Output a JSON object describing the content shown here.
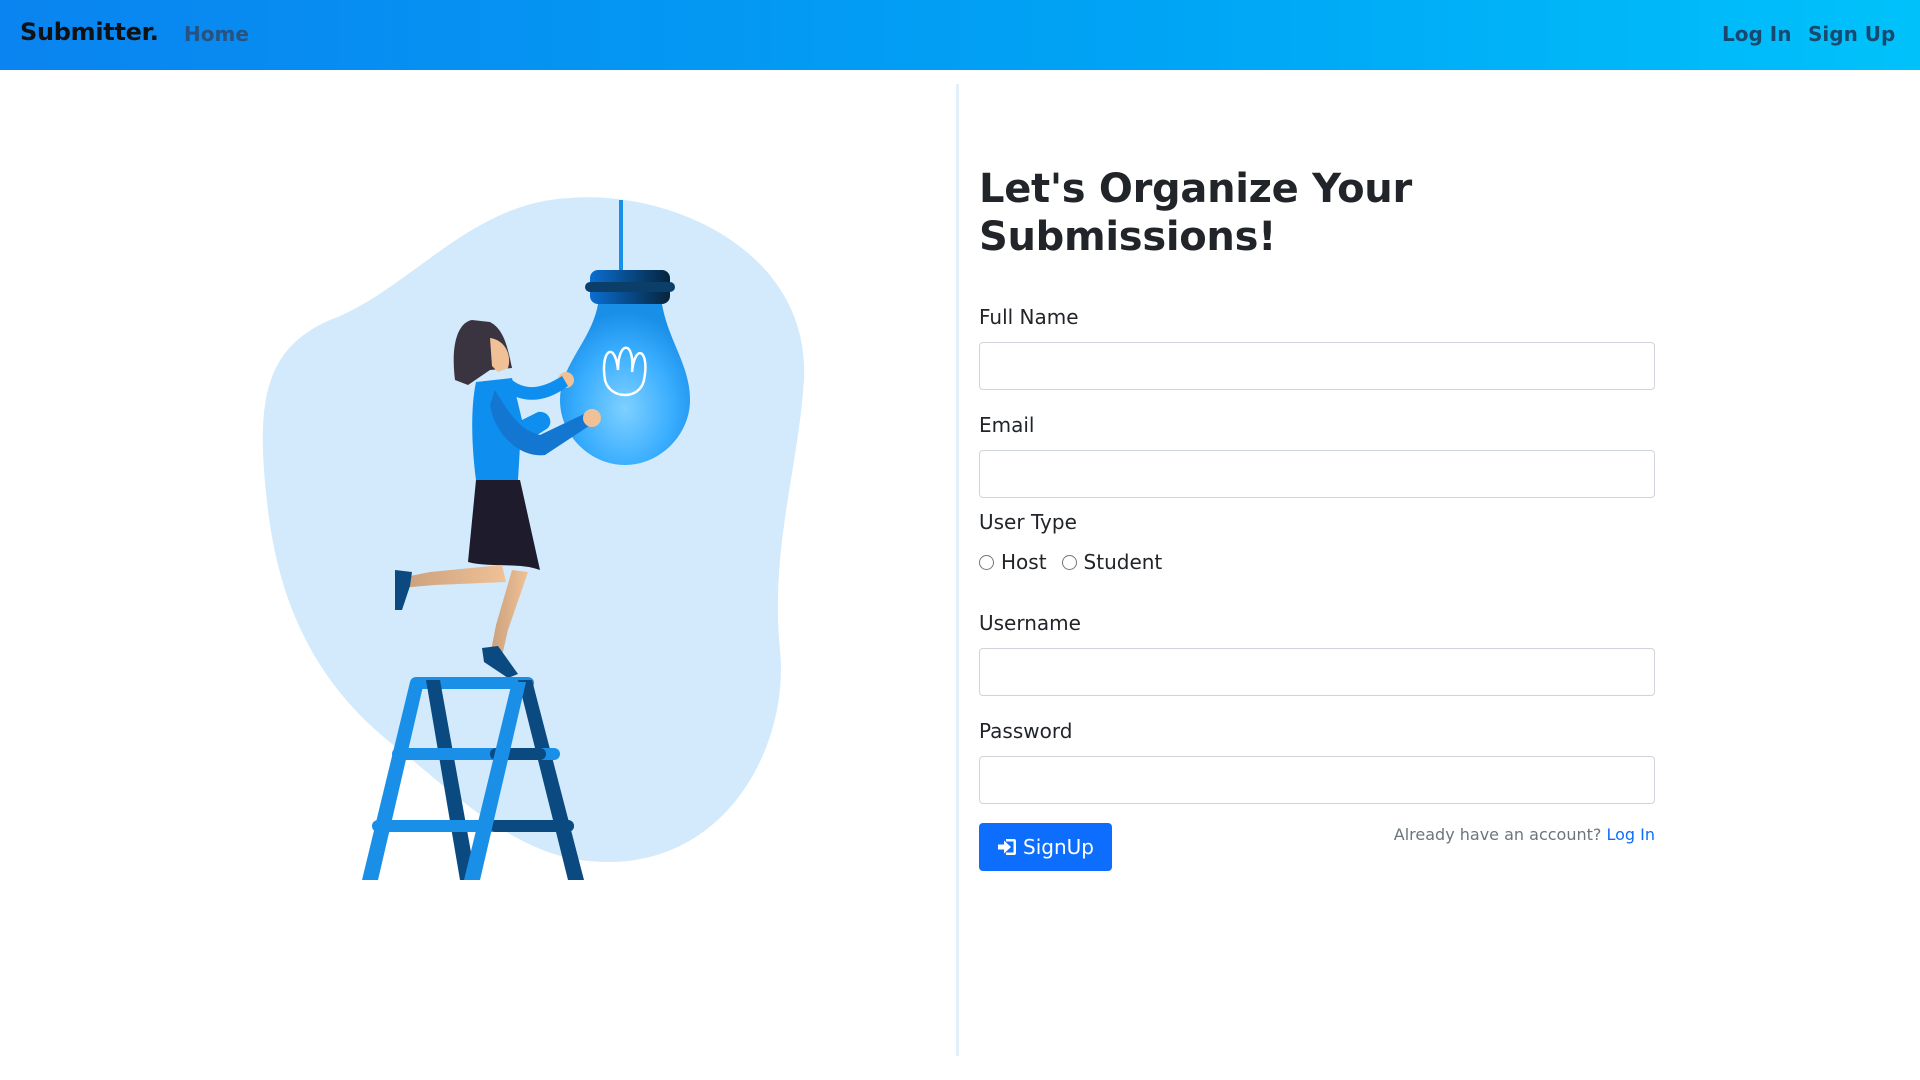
{
  "navbar": {
    "brand": "Submitter.",
    "home": "Home",
    "login": "Log In",
    "signup": "Sign Up"
  },
  "form": {
    "title": "Let's Organize Your Submissions!",
    "fullname_label": "Full Name",
    "fullname_value": "",
    "email_label": "Email",
    "email_value": "",
    "usertype_label": "User Type",
    "usertype_options": [
      "Host",
      "Student"
    ],
    "username_label": "Username",
    "username_value": "",
    "password_label": "Password",
    "password_value": "",
    "signup_button": "SignUp",
    "already_text": "Already have an account?",
    "login_link": "Log In"
  },
  "colors": {
    "primary": "#0d6efd",
    "navbar_start": "#0a84f0",
    "navbar_end": "#00c2fb",
    "blob": "#d2eafc"
  },
  "icons": {
    "signup": "sign-in-icon"
  }
}
